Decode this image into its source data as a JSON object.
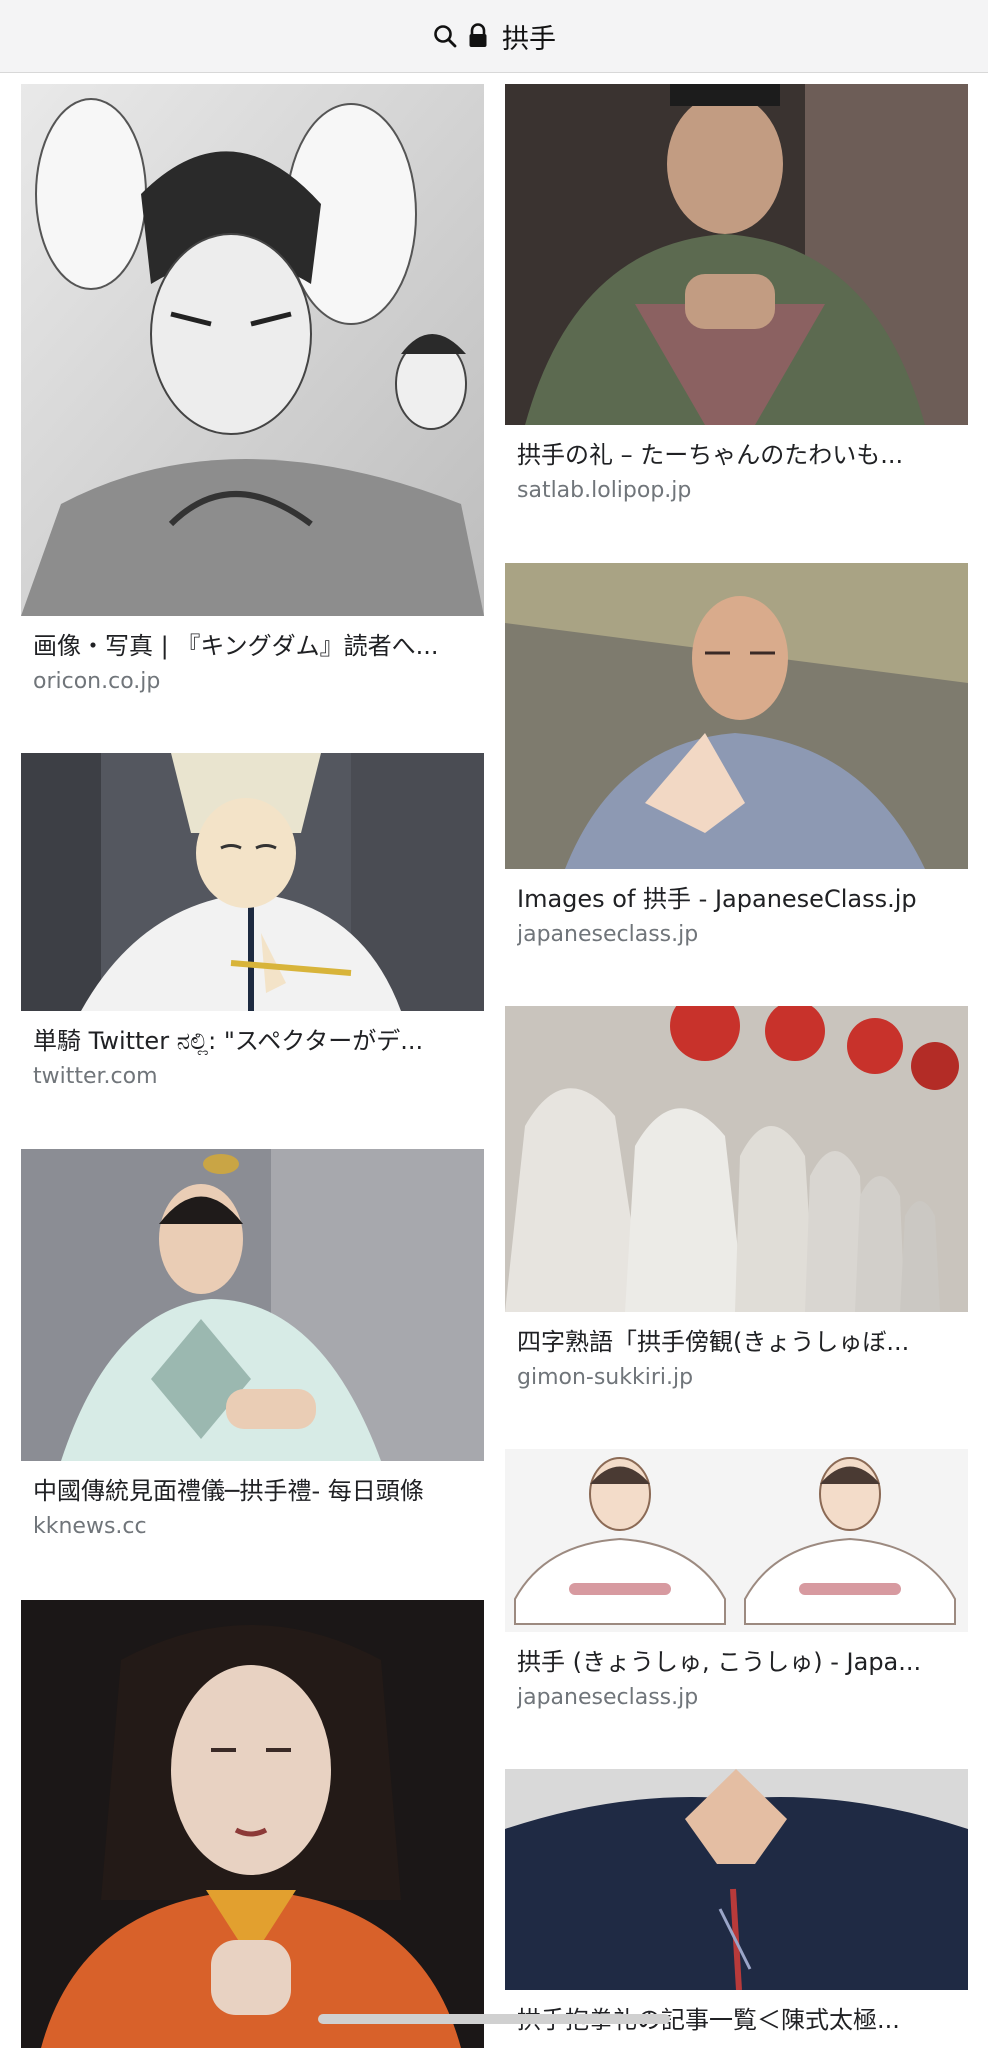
{
  "search": {
    "query": "拱手"
  },
  "results_left": [
    {
      "title": "画像・写真 | 『キングダム』読者へ...",
      "source": "oricon.co.jp",
      "image": "manga-illustration"
    },
    {
      "title": "単騎 Twitter ನಲ್ಲಿ: \"スペクターがデ...",
      "source": "twitter.com",
      "image": "anime-character"
    },
    {
      "title": "中國傳統見面禮儀─拱手禮- 每日頭條",
      "source": "kknews.cc",
      "image": "costume-drama-man"
    },
    {
      "title": "",
      "source": "",
      "image": "woman-orange-robe"
    }
  ],
  "results_right": [
    {
      "title": "拱手の礼 – たーちゃんのたわいも...",
      "source": "satlab.lolipop.jp",
      "image": "actor-green-robe"
    },
    {
      "title": "Images of 拱手 - JapaneseClass.jp",
      "source": "japaneseclass.jp",
      "image": "monk-salute"
    },
    {
      "title": "四字熟語「拱手傍観(きょうしゅぼ...",
      "source": "gimon-sukkiri.jp",
      "image": "stone-statues"
    },
    {
      "title": "拱手 (きょうしゅ, こうしゅ) - Japa...",
      "source": "japaneseclass.jp",
      "image": "salute-drawing"
    },
    {
      "title": "拱手抱拳礼の記事一覧＜陳式太極...",
      "source": "",
      "image": "hands-closeup"
    }
  ],
  "icons": {
    "search": "search-icon",
    "lock": "lock-icon"
  }
}
